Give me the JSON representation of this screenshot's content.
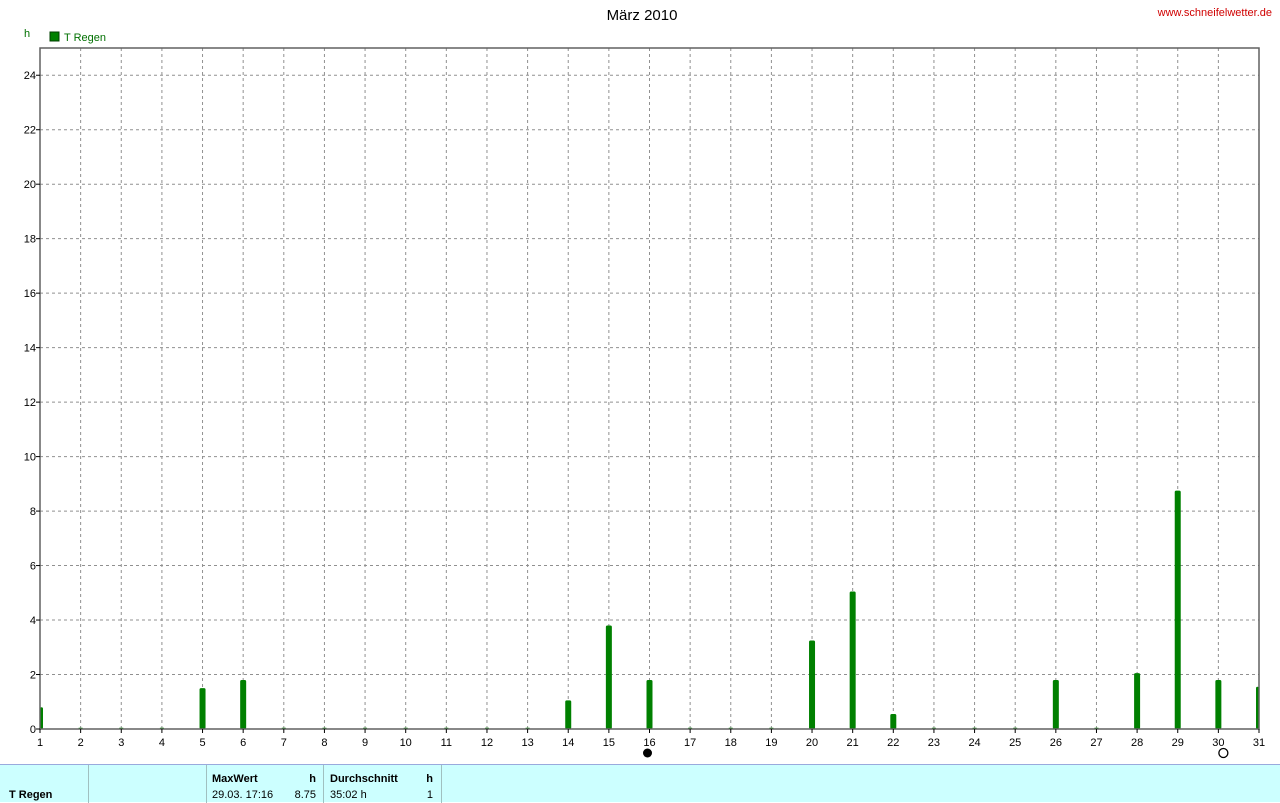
{
  "chart_data": {
    "type": "bar",
    "title": "März 2010",
    "ylabel": "h",
    "ylim": [
      0,
      25
    ],
    "y_ticks": [
      0,
      2,
      4,
      6,
      8,
      10,
      12,
      14,
      16,
      18,
      20,
      22,
      24
    ],
    "categories": [
      "1",
      "2",
      "3",
      "4",
      "5",
      "6",
      "7",
      "8",
      "9",
      "10",
      "11",
      "12",
      "13",
      "14",
      "15",
      "16",
      "17",
      "18",
      "19",
      "20",
      "21",
      "22",
      "23",
      "24",
      "25",
      "26",
      "27",
      "28",
      "29",
      "30",
      "31"
    ],
    "series": [
      {
        "name": "T Regen",
        "color": "#008000",
        "values": [
          0.8,
          0,
          0,
          0,
          1.5,
          1.8,
          0,
          0,
          0,
          0,
          0,
          0,
          0,
          1.05,
          3.8,
          1.8,
          0,
          0,
          0,
          3.25,
          5.05,
          0.55,
          0,
          0,
          0,
          1.8,
          0,
          2.05,
          8.75,
          1.8,
          1.55
        ]
      }
    ],
    "grid": true,
    "legend_position": "top-left",
    "moon_phases": [
      {
        "day": 16,
        "phase": "new-moon"
      },
      {
        "day": 30,
        "phase": "full-moon"
      }
    ]
  },
  "source_url": "www.schneifelwetter.de",
  "footer": {
    "series_label": "T Regen",
    "max_header": "MaxWert",
    "max_unit": "h",
    "max_when": "29.03.  17:16",
    "max_value": "8.75",
    "avg_header": "Durchschnitt",
    "avg_unit": "h",
    "avg_value": "35:02 h",
    "avg_extra": "1"
  }
}
